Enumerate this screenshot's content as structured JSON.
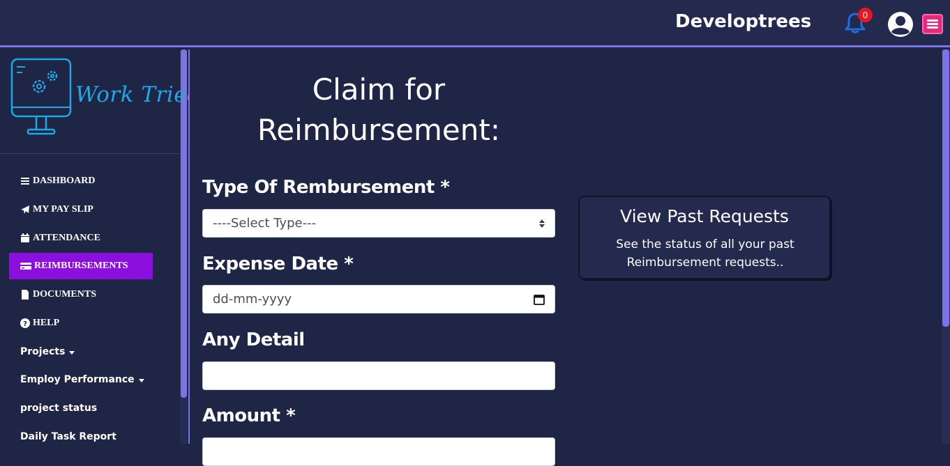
{
  "header": {
    "brand": "Developtrees",
    "notification_count": "0",
    "bell_icon": "bell-icon",
    "avatar_icon": "user-circle-icon",
    "menu_icon": "hamburger-icon",
    "colors": {
      "bar": "#232a4e",
      "accent": "#7b73e6",
      "badge": "#e8161f",
      "menu": "#e8287c",
      "bell": "#1e6fe0"
    }
  },
  "sidebar": {
    "logo_text": "Work Tried",
    "items": [
      {
        "label": "DASHBOARD",
        "icon": "list-icon"
      },
      {
        "label": "MY PAY SLIP",
        "icon": "paper-plane-icon"
      },
      {
        "label": "ATTENDANCE",
        "icon": "calendar-icon"
      },
      {
        "label": "REIMBURSEMENTS",
        "icon": "credit-card-icon",
        "active": true
      },
      {
        "label": "DOCUMENTS",
        "icon": "file-icon"
      },
      {
        "label": "HELP",
        "icon": "question-circle-icon"
      },
      {
        "label": "Projects"
      },
      {
        "label": "Employ Performance"
      },
      {
        "label": "project status"
      },
      {
        "label": "Daily Task Report"
      }
    ],
    "active_color": "#8b10e0"
  },
  "main": {
    "title": "Claim for Reimbursement:",
    "form": {
      "type_label": "Type Of Rembursement *",
      "type_value": "----Select Type---",
      "date_label": "Expense Date *",
      "date_placeholder": "dd-mm-yyyy",
      "detail_label": "Any Detail",
      "detail_value": "",
      "amount_label": "Amount *"
    },
    "past_requests": {
      "title": "View Past Requests",
      "description": "See the status of all your past Reimbursement requests.."
    }
  }
}
